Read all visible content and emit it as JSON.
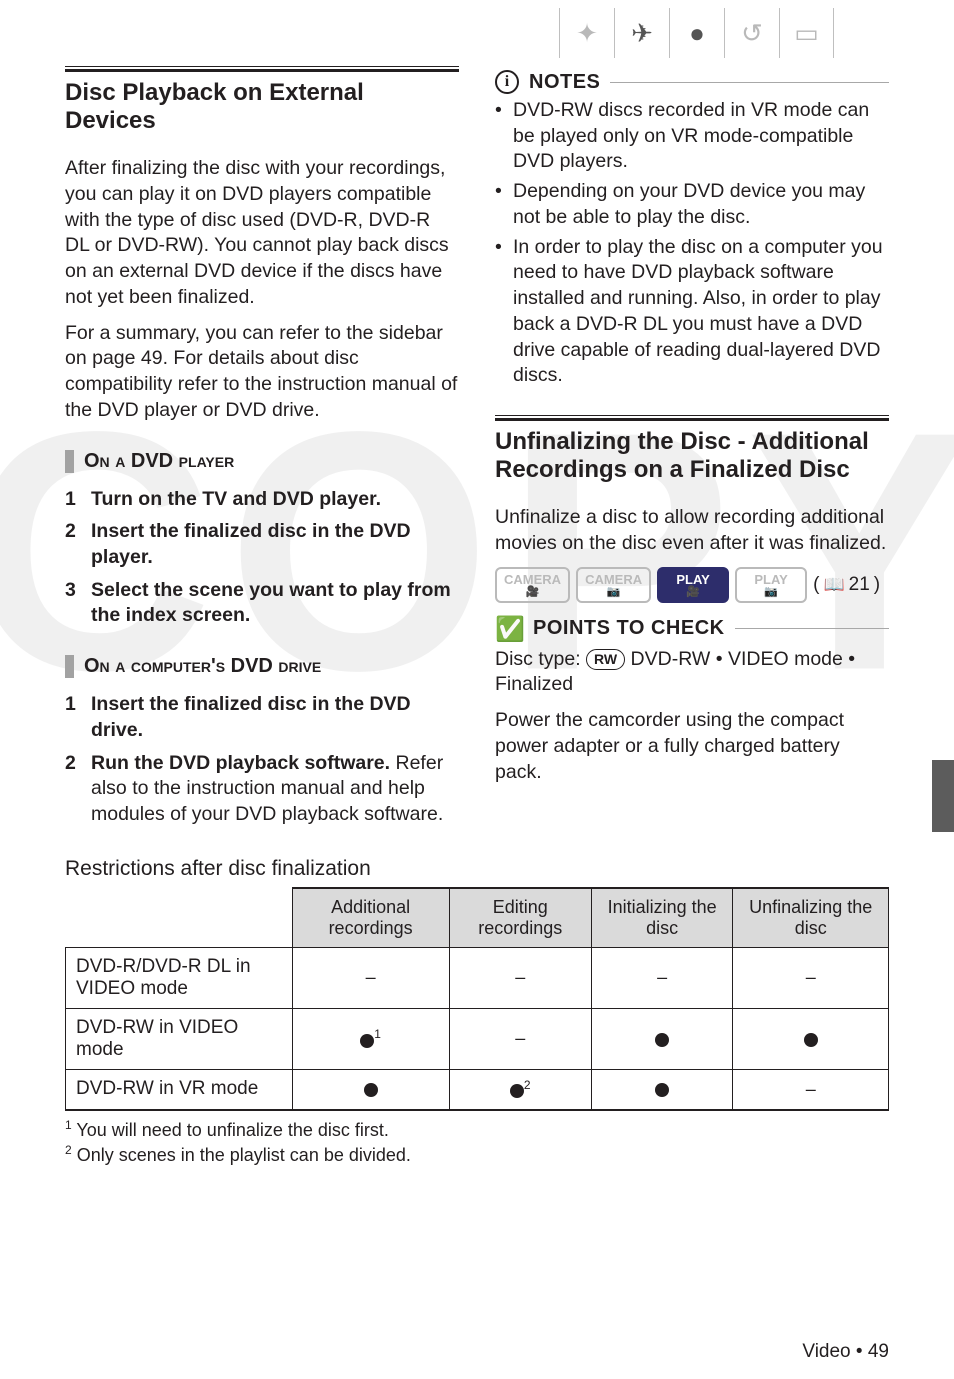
{
  "watermark": "COPY",
  "top_icons": [
    "✦",
    "✈",
    "●",
    "↺",
    "▭"
  ],
  "left": {
    "section1_title": "Disc Playback on External Devices",
    "para1": "After finalizing the disc with your recordings, you can play it on DVD players compatible with the type of disc used (DVD-R, DVD-R DL or DVD-RW). You cannot play back discs on an external DVD device if the discs have not yet been finalized.",
    "para2": "For a summary, you can refer to the sidebar on page 49. For details about disc compatibility refer to the instruction manual of the DVD player or DVD drive.",
    "sub1": "On a DVD player",
    "steps1": [
      "Turn on the TV and DVD player.",
      "Insert the finalized disc in the DVD player.",
      "Select the scene you want to play from the index screen."
    ],
    "sub2": "On a computer's DVD drive",
    "steps2": [
      {
        "bold": "Insert the finalized disc in the DVD drive.",
        "rest": ""
      },
      {
        "bold": "Run the DVD playback software.",
        "rest": "Refer also to the instruction manual and help modules of your DVD playback software."
      }
    ]
  },
  "right": {
    "notes_label": "NOTES",
    "notes": [
      "DVD-RW discs recorded in VR mode can be played only on VR mode-compatible DVD players.",
      "Depending on your DVD device you may not be able to play the disc.",
      "In order to play the disc on a computer you need to have DVD playback software installed and running. Also, in order to play back a DVD-R DL you must have a DVD drive capable of reading dual-layered DVD discs."
    ],
    "section2_title": "Unfinalizing the Disc - Additional Recordings on a Finalized Disc",
    "para1": "Unfinalize a disc to allow recording additional movies on the disc even after it was finalized.",
    "modes": [
      "CAMERA",
      "CAMERA",
      "PLAY",
      "PLAY"
    ],
    "mode_subs": [
      "🎥",
      "📷",
      "🎥",
      "📷"
    ],
    "page_ref": "21",
    "points_label": "POINTS TO CHECK",
    "disc_type_pre": "Disc type: ",
    "disc_type_badge": "RW",
    "disc_type_post": " DVD-RW • VIDEO mode • Finalized",
    "power_text": "Power the camcorder using the compact power adapter or a fully charged battery pack."
  },
  "table": {
    "title": "Restrictions after disc finalization",
    "headers": [
      "Additional recordings",
      "Editing recordings",
      "Initializing the disc",
      "Unfinalizing the disc"
    ],
    "rows": [
      {
        "label": "DVD-R/DVD-R DL in VIDEO mode",
        "cells": [
          "–",
          "–",
          "–",
          "–"
        ]
      },
      {
        "label": "DVD-RW in VIDEO mode",
        "cells": [
          "dot1",
          "–",
          "dot",
          "dot"
        ]
      },
      {
        "label": "DVD-RW in VR mode",
        "cells": [
          "dot",
          "dot2",
          "dot",
          "–"
        ]
      }
    ],
    "footnote1": "You will need to unfinalize the disc first.",
    "footnote2": "Only scenes in the playlist can be divided."
  },
  "footer": {
    "section": "Video",
    "page": "49"
  }
}
